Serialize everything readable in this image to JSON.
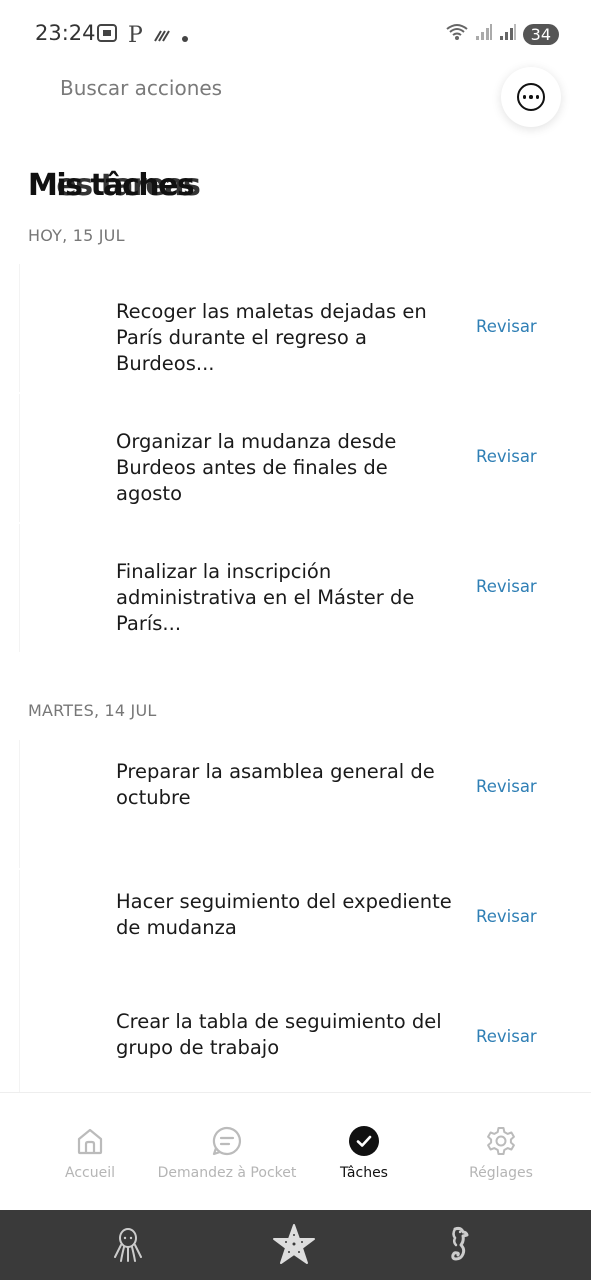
{
  "status_bar": {
    "time": "23:24",
    "left_icons": [
      "screenshot-icon",
      "p-icon",
      "signal-lines-icon",
      "dot-icon"
    ],
    "p_glyph": "P",
    "battery": "34"
  },
  "header": {
    "search_placeholder": "Buscar acciones",
    "title_primary": "Mis tâches",
    "title_overlap": "Mes tareas"
  },
  "sections": [
    {
      "date": "HOY, 15 JUL",
      "tasks": [
        {
          "text": "Recoger las maletas dejadas en París durante el regreso a Burdeos...",
          "action": "Revisar"
        },
        {
          "text": "Organizar la mudanza desde Burdeos antes de finales de agosto",
          "action": "Revisar"
        },
        {
          "text": "Finalizar la inscripción administrativa en el Máster de París...",
          "action": "Revisar"
        }
      ]
    },
    {
      "date": "MARTES, 14 JUL",
      "tasks": [
        {
          "text": "Preparar la asamblea general de octubre",
          "action": "Revisar"
        },
        {
          "text": "Hacer seguimiento del expediente de mudanza",
          "action": "Revisar"
        },
        {
          "text": "Crear la tabla de seguimiento del grupo de trabajo",
          "action": "Revisar"
        }
      ]
    }
  ],
  "bottom_nav": [
    {
      "label": "Accueil",
      "icon": "home-icon",
      "active": false
    },
    {
      "label": "Demandez à Pocket",
      "icon": "chat-icon",
      "active": false
    },
    {
      "label": "Tâches",
      "icon": "check-circle-icon",
      "active": true
    },
    {
      "label": "Réglages",
      "icon": "gear-icon",
      "active": false
    }
  ],
  "system_bar": {
    "buttons": [
      "octopus-icon",
      "starfish-icon",
      "seahorse-icon"
    ]
  },
  "colors": {
    "accent_link": "#2f7fb5",
    "inactive_nav": "#b5b5b5",
    "system_bar": "#3a3a3a"
  }
}
